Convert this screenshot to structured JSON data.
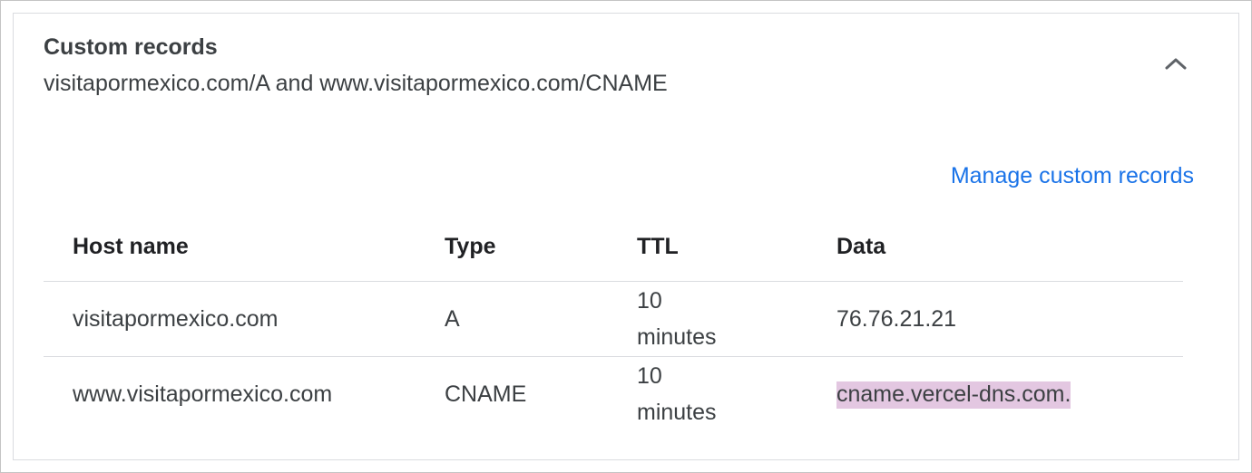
{
  "section": {
    "title": "Custom records",
    "subtitle": "visitapormexico.com/A and www.visitapormexico.com/CNAME",
    "manage_link": "Manage custom records",
    "collapse_icon": "chevron-up-icon"
  },
  "table": {
    "headers": {
      "host": "Host name",
      "type": "Type",
      "ttl": "TTL",
      "data": "Data"
    },
    "rows": [
      {
        "host": "visitapormexico.com",
        "type": "A",
        "ttl": "10 minutes",
        "data": "76.76.21.21"
      },
      {
        "host": "www.visitapormexico.com",
        "type": "CNAME",
        "ttl": "10 minutes",
        "data": "cname.vercel-dns.com."
      }
    ]
  },
  "colors": {
    "link": "#1a73e8",
    "highlight": "#e3c7e1"
  }
}
